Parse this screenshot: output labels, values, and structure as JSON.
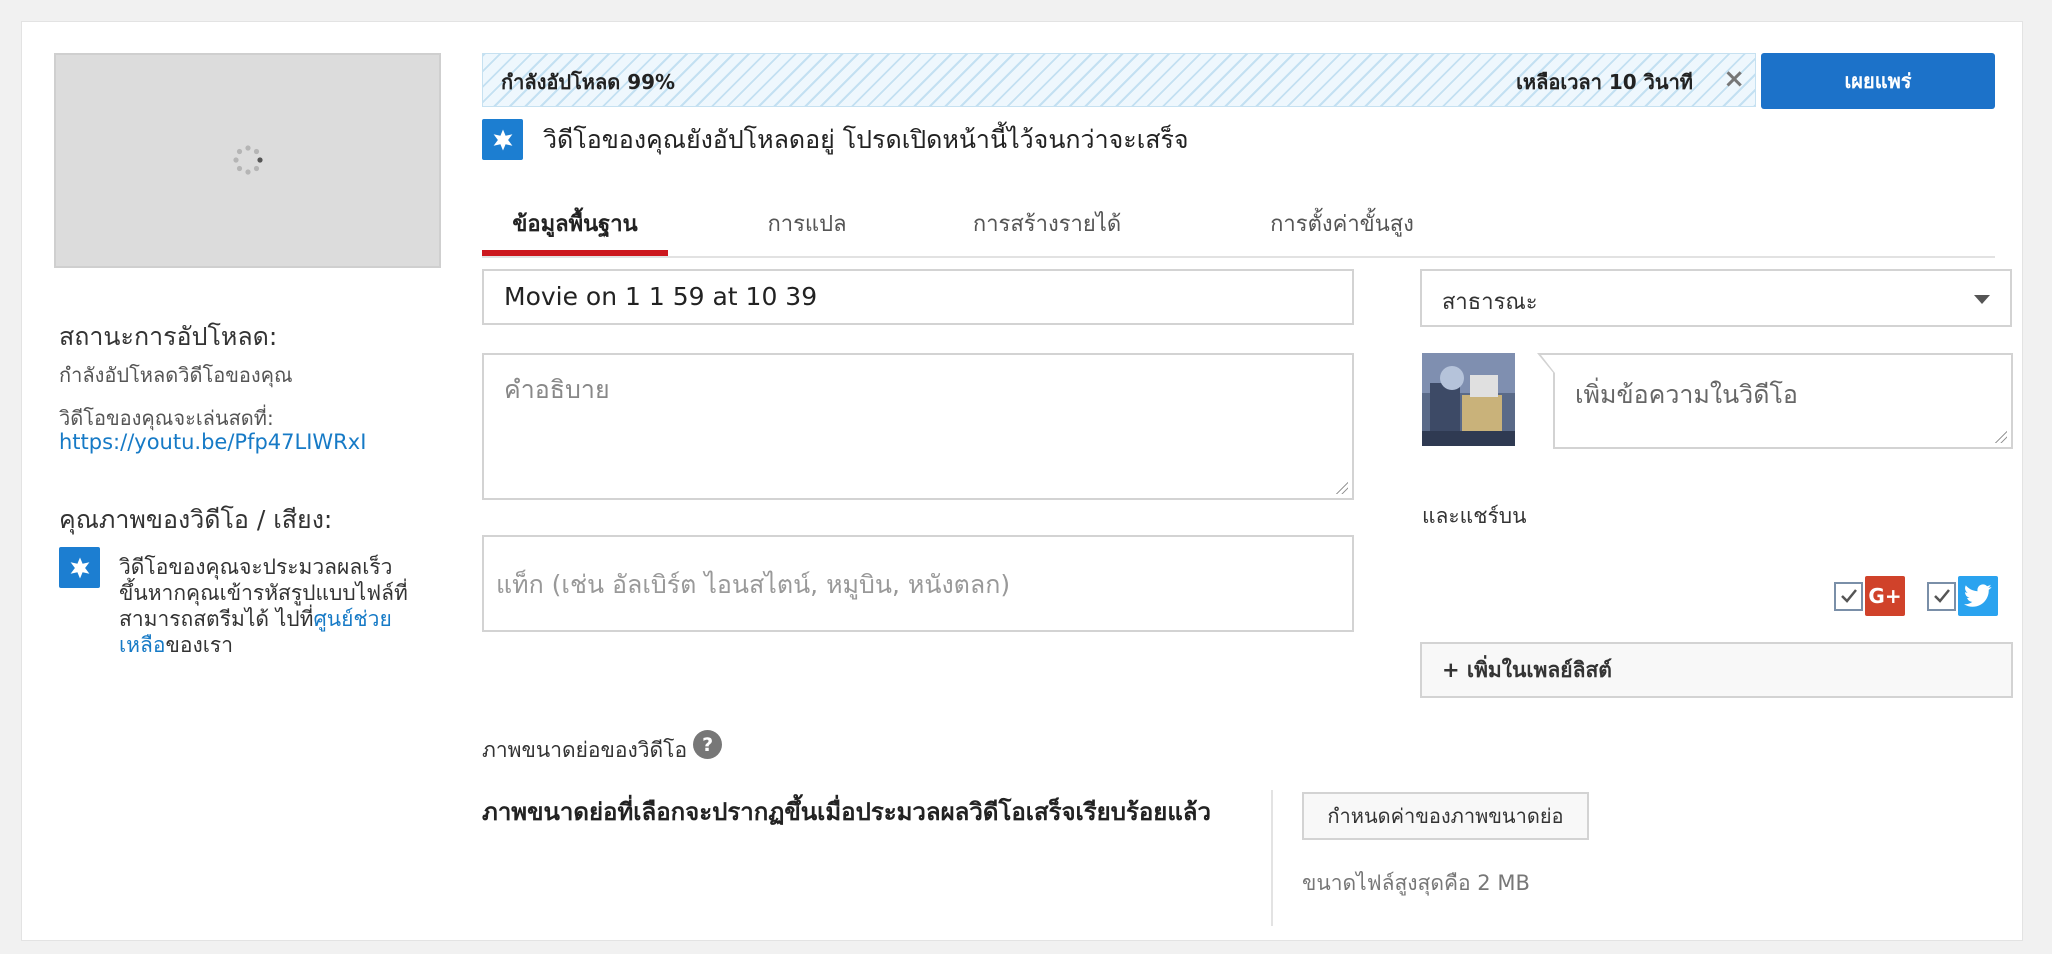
{
  "sidebar": {
    "upload_status_heading": "สถานะการอัปโหลด:",
    "upload_status_text": "กำลังอัปโหลดวิดีโอของคุณ",
    "live_at_label": "วิดีโอของคุณจะเล่นสดที่:",
    "video_url": "https://youtu.be/Pfp47LIWRxI",
    "quality_heading": "คุณภาพของวิดีโอ / เสียง:",
    "quality_text_1": "วิดีโอของคุณจะประมวลผลเร็วขึ้นหากคุณเข้ารหัสรูปแบบไฟล์ที่สามารถสตรีมได้ ไปที่",
    "quality_link": "ศูนย์ช่วยเหลือ",
    "quality_text_2": "ของเรา"
  },
  "progress": {
    "label": "กำลังอัปโหลด 99%",
    "percent": 99,
    "remaining": "เหลือเวลา 10 วินาที",
    "close_glyph": "×"
  },
  "toolbar": {
    "publish_label": "เผยแพร่"
  },
  "notice": {
    "text": "วิดีโอของคุณยังอัปโหลดอยู่ โปรดเปิดหน้านี้ไว้จนกว่าจะเสร็จ"
  },
  "tabs": [
    {
      "label": "ข้อมูลพื้นฐาน",
      "active": true
    },
    {
      "label": "การแปล",
      "active": false
    },
    {
      "label": "การสร้างรายได้",
      "active": false
    },
    {
      "label": "การตั้งค่าขั้นสูง",
      "active": false
    }
  ],
  "form": {
    "title_value": "Movie on 1 1 59 at 10 39",
    "description_placeholder": "คำอธิบาย",
    "tags_placeholder": "แท็ก (เช่น อัลเบิร์ต ไอนสไตน์, หมูบิน, หนังตลก)",
    "privacy_selected": "สาธารณะ",
    "share_message_placeholder": "เพิ่มข้อความในวิดีโอ",
    "share_label": "และแชร์บน",
    "share_targets": [
      {
        "name": "Google+",
        "checked": true,
        "glyph": "G+",
        "color": "#d0422a"
      },
      {
        "name": "Twitter",
        "checked": true,
        "glyph": "twitter-bird",
        "color": "#2aa3ef"
      }
    ],
    "add_playlist_label": "+ เพิ่มในเพลย์ลิสต์"
  },
  "thumbnail": {
    "heading": "ภาพขนาดย่อของวิดีโอ",
    "help_glyph": "?",
    "note": "ภาพขนาดย่อที่เลือกจะปรากฏขึ้นเมื่อประมวลผลวิดีโอเสร็จเรียบร้อยแล้ว",
    "custom_button_label": "กำหนดค่าของภาพขนาดย่อ",
    "max_size_text": "ขนาดไฟล์สูงสุดคือ 2 MB"
  },
  "colors": {
    "publish_blue": "#1c72c9",
    "active_tab_red": "#cc181e",
    "link_blue": "#167ac6",
    "star_blue": "#1c7ed1"
  }
}
